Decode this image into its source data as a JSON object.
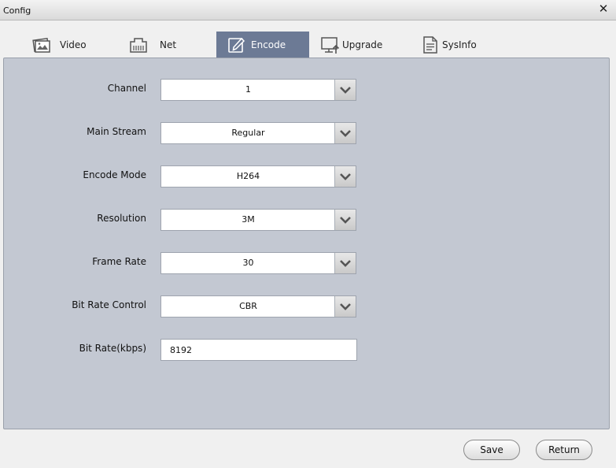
{
  "window": {
    "title": "Config",
    "close_glyph": "✕"
  },
  "tabs": [
    {
      "label": "Video",
      "icon": "video-icon"
    },
    {
      "label": "Net",
      "icon": "network-icon"
    },
    {
      "label": "Encode",
      "icon": "edit-icon",
      "active": true
    },
    {
      "label": "Upgrade",
      "icon": "upgrade-icon"
    },
    {
      "label": "SysInfo",
      "icon": "document-icon"
    }
  ],
  "form": {
    "channel": {
      "label": "Channel",
      "value": "1"
    },
    "main_stream": {
      "label": "Main Stream",
      "value": "Regular"
    },
    "encode_mode": {
      "label": "Encode Mode",
      "value": "H264"
    },
    "resolution": {
      "label": "Resolution",
      "value": "3M"
    },
    "frame_rate": {
      "label": "Frame Rate",
      "value": "30"
    },
    "bit_rate_control": {
      "label": "Bit Rate Control",
      "value": "CBR"
    },
    "bit_rate": {
      "label": "Bit Rate(kbps)",
      "value": "8192"
    }
  },
  "buttons": {
    "save": "Save",
    "return": "Return"
  },
  "colors": {
    "active_tab": "#6c7a95",
    "panel": "#c3c8d2"
  }
}
